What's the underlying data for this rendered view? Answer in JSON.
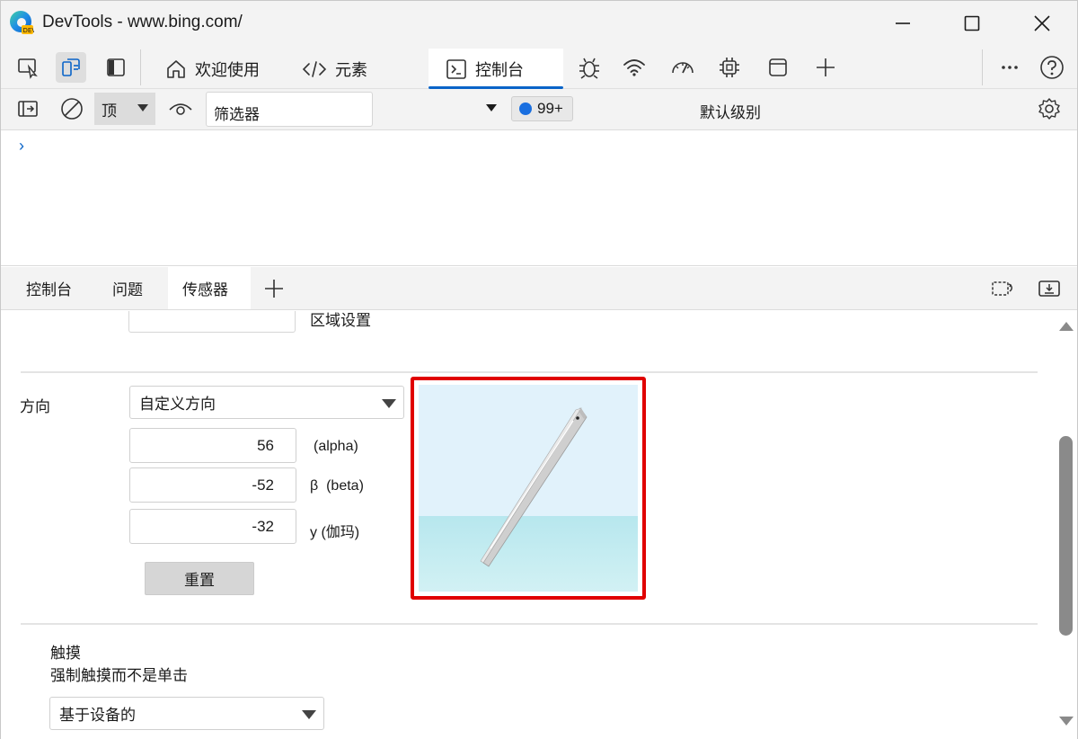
{
  "window": {
    "title": "DevTools - www.bing.com/"
  },
  "toolbar": {
    "tabs": [
      {
        "label": "欢迎使用",
        "icon": "home-icon"
      },
      {
        "label": "元素",
        "icon": "code-icon"
      },
      {
        "label": "控制台",
        "icon": "console-icon",
        "selected": true
      }
    ],
    "more_tools_icons": [
      "bug-icon",
      "wifi-icon",
      "performance-icon",
      "cpu-icon",
      "application-icon",
      "add-icon"
    ]
  },
  "console_toolbar": {
    "context": "顶",
    "filter_placeholder": "筛选器",
    "message_count": "99+",
    "levels": "默认级别"
  },
  "console": {
    "prompt": "›"
  },
  "drawer": {
    "tabs": [
      {
        "label": "控制台"
      },
      {
        "label": "问题"
      },
      {
        "label": "传感器",
        "selected": true
      }
    ]
  },
  "sensors": {
    "region_label": "区域设置",
    "orientation": {
      "label": "方向",
      "preset": "自定义方向",
      "alpha": {
        "value": "56",
        "label": "(alpha)"
      },
      "beta": {
        "value": "-52",
        "label": "β  (beta)"
      },
      "gamma": {
        "value": "-32",
        "label": "y (伽玛)"
      },
      "reset": "重置"
    },
    "touch": {
      "title": "触摸",
      "description": "强制触摸而不是单击",
      "option": "基于设备的"
    }
  },
  "colors": {
    "accent": "#0a64c8",
    "highlight": "#e00000",
    "scene_sky": "#e1f2fb",
    "scene_floor": "#b7e7ee"
  }
}
